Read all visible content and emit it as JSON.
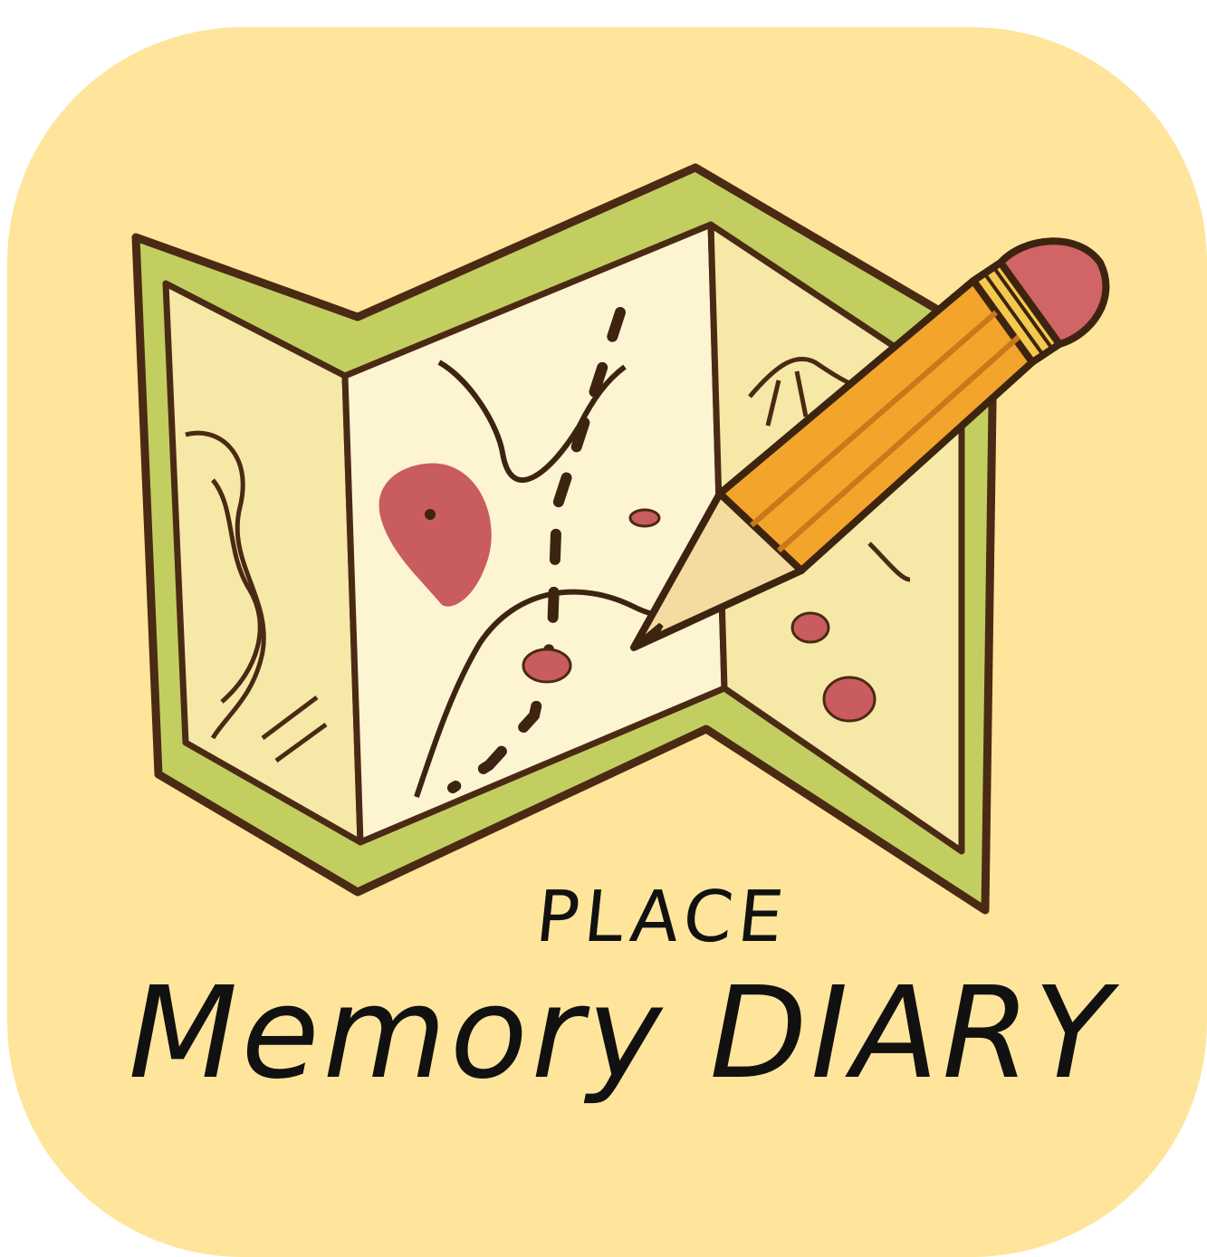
{
  "app_icon": {
    "title_line1": "PLACE",
    "title_line2": "Memory DIARY",
    "background_color": "#fee59b",
    "icons": [
      "folded-map-icon",
      "pencil-icon",
      "location-pin-icon"
    ]
  }
}
